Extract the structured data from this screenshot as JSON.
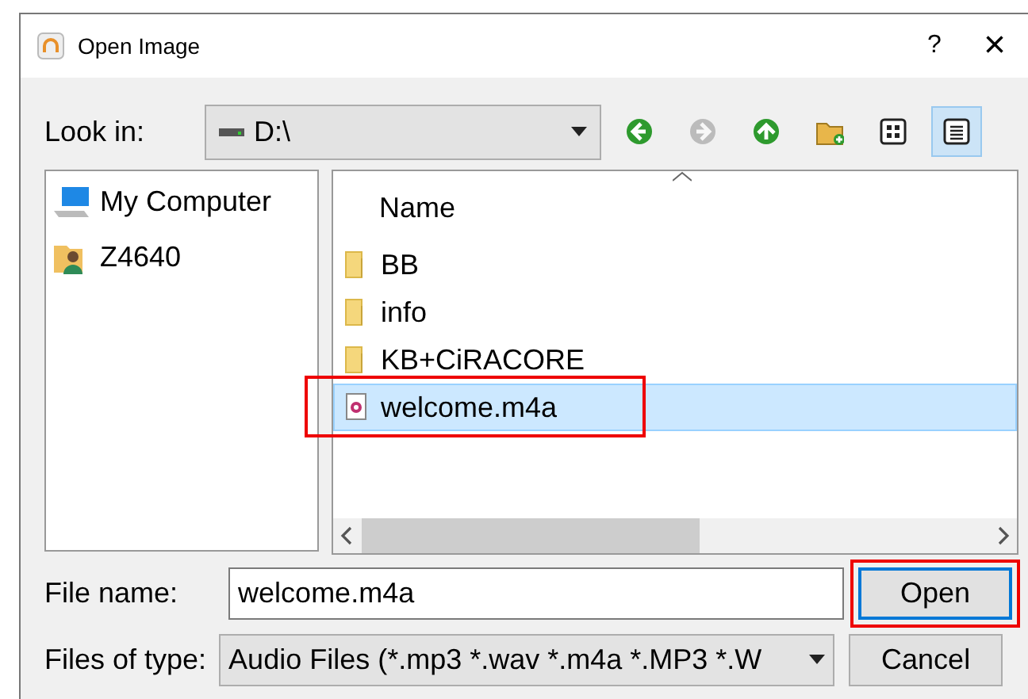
{
  "window": {
    "title": "Open Image",
    "help": "?",
    "close": "×"
  },
  "look_in": {
    "label": "Look in:",
    "value": "D:\\"
  },
  "toolbar": [
    {
      "kind": "back",
      "disabled": false,
      "selected": false
    },
    {
      "kind": "forward",
      "disabled": true,
      "selected": false
    },
    {
      "kind": "up",
      "disabled": false,
      "selected": false
    },
    {
      "kind": "new_folder",
      "disabled": false,
      "selected": false
    },
    {
      "kind": "list_view",
      "disabled": false,
      "selected": false
    },
    {
      "kind": "detail_view",
      "disabled": false,
      "selected": true
    }
  ],
  "sidebar": {
    "items": [
      {
        "kind": "computer",
        "label": "My Computer"
      },
      {
        "kind": "user",
        "label": "Z4640"
      }
    ]
  },
  "files": {
    "columns": [
      "Name"
    ],
    "rows": [
      {
        "kind": "folder",
        "name": "BB",
        "selected": false,
        "highlighted": false
      },
      {
        "kind": "folder",
        "name": "info",
        "selected": false,
        "highlighted": false
      },
      {
        "kind": "folder",
        "name": "KB+CiRACORE",
        "selected": false,
        "highlighted": false
      },
      {
        "kind": "audio",
        "name": "welcome.m4a",
        "selected": true,
        "highlighted": true
      }
    ]
  },
  "file_name": {
    "label": "File name:",
    "value": "welcome.m4a"
  },
  "file_type": {
    "label": "Files of type:",
    "value": "Audio Files (*.mp3 *.wav *.m4a *.MP3 *.W"
  },
  "buttons": [
    {
      "label": "Open",
      "default": true,
      "highlighted": true
    },
    {
      "label": "Cancel",
      "default": false,
      "highlighted": false
    }
  ]
}
